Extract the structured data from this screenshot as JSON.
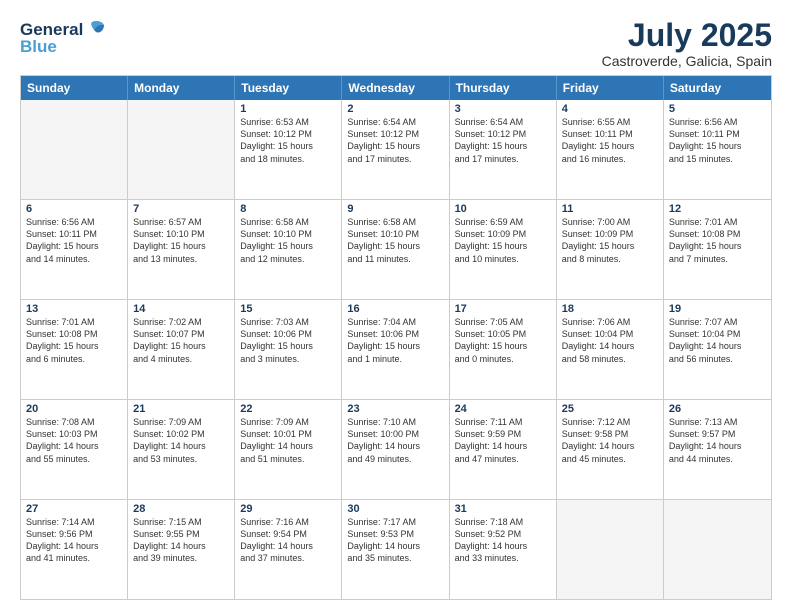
{
  "header": {
    "logo_line1": "General",
    "logo_line2": "Blue",
    "month": "July 2025",
    "location": "Castroverde, Galicia, Spain"
  },
  "weekdays": [
    "Sunday",
    "Monday",
    "Tuesday",
    "Wednesday",
    "Thursday",
    "Friday",
    "Saturday"
  ],
  "rows": [
    [
      {
        "day": "",
        "info": ""
      },
      {
        "day": "",
        "info": ""
      },
      {
        "day": "1",
        "info": "Sunrise: 6:53 AM\nSunset: 10:12 PM\nDaylight: 15 hours\nand 18 minutes."
      },
      {
        "day": "2",
        "info": "Sunrise: 6:54 AM\nSunset: 10:12 PM\nDaylight: 15 hours\nand 17 minutes."
      },
      {
        "day": "3",
        "info": "Sunrise: 6:54 AM\nSunset: 10:12 PM\nDaylight: 15 hours\nand 17 minutes."
      },
      {
        "day": "4",
        "info": "Sunrise: 6:55 AM\nSunset: 10:11 PM\nDaylight: 15 hours\nand 16 minutes."
      },
      {
        "day": "5",
        "info": "Sunrise: 6:56 AM\nSunset: 10:11 PM\nDaylight: 15 hours\nand 15 minutes."
      }
    ],
    [
      {
        "day": "6",
        "info": "Sunrise: 6:56 AM\nSunset: 10:11 PM\nDaylight: 15 hours\nand 14 minutes."
      },
      {
        "day": "7",
        "info": "Sunrise: 6:57 AM\nSunset: 10:10 PM\nDaylight: 15 hours\nand 13 minutes."
      },
      {
        "day": "8",
        "info": "Sunrise: 6:58 AM\nSunset: 10:10 PM\nDaylight: 15 hours\nand 12 minutes."
      },
      {
        "day": "9",
        "info": "Sunrise: 6:58 AM\nSunset: 10:10 PM\nDaylight: 15 hours\nand 11 minutes."
      },
      {
        "day": "10",
        "info": "Sunrise: 6:59 AM\nSunset: 10:09 PM\nDaylight: 15 hours\nand 10 minutes."
      },
      {
        "day": "11",
        "info": "Sunrise: 7:00 AM\nSunset: 10:09 PM\nDaylight: 15 hours\nand 8 minutes."
      },
      {
        "day": "12",
        "info": "Sunrise: 7:01 AM\nSunset: 10:08 PM\nDaylight: 15 hours\nand 7 minutes."
      }
    ],
    [
      {
        "day": "13",
        "info": "Sunrise: 7:01 AM\nSunset: 10:08 PM\nDaylight: 15 hours\nand 6 minutes."
      },
      {
        "day": "14",
        "info": "Sunrise: 7:02 AM\nSunset: 10:07 PM\nDaylight: 15 hours\nand 4 minutes."
      },
      {
        "day": "15",
        "info": "Sunrise: 7:03 AM\nSunset: 10:06 PM\nDaylight: 15 hours\nand 3 minutes."
      },
      {
        "day": "16",
        "info": "Sunrise: 7:04 AM\nSunset: 10:06 PM\nDaylight: 15 hours\nand 1 minute."
      },
      {
        "day": "17",
        "info": "Sunrise: 7:05 AM\nSunset: 10:05 PM\nDaylight: 15 hours\nand 0 minutes."
      },
      {
        "day": "18",
        "info": "Sunrise: 7:06 AM\nSunset: 10:04 PM\nDaylight: 14 hours\nand 58 minutes."
      },
      {
        "day": "19",
        "info": "Sunrise: 7:07 AM\nSunset: 10:04 PM\nDaylight: 14 hours\nand 56 minutes."
      }
    ],
    [
      {
        "day": "20",
        "info": "Sunrise: 7:08 AM\nSunset: 10:03 PM\nDaylight: 14 hours\nand 55 minutes."
      },
      {
        "day": "21",
        "info": "Sunrise: 7:09 AM\nSunset: 10:02 PM\nDaylight: 14 hours\nand 53 minutes."
      },
      {
        "day": "22",
        "info": "Sunrise: 7:09 AM\nSunset: 10:01 PM\nDaylight: 14 hours\nand 51 minutes."
      },
      {
        "day": "23",
        "info": "Sunrise: 7:10 AM\nSunset: 10:00 PM\nDaylight: 14 hours\nand 49 minutes."
      },
      {
        "day": "24",
        "info": "Sunrise: 7:11 AM\nSunset: 9:59 PM\nDaylight: 14 hours\nand 47 minutes."
      },
      {
        "day": "25",
        "info": "Sunrise: 7:12 AM\nSunset: 9:58 PM\nDaylight: 14 hours\nand 45 minutes."
      },
      {
        "day": "26",
        "info": "Sunrise: 7:13 AM\nSunset: 9:57 PM\nDaylight: 14 hours\nand 44 minutes."
      }
    ],
    [
      {
        "day": "27",
        "info": "Sunrise: 7:14 AM\nSunset: 9:56 PM\nDaylight: 14 hours\nand 41 minutes."
      },
      {
        "day": "28",
        "info": "Sunrise: 7:15 AM\nSunset: 9:55 PM\nDaylight: 14 hours\nand 39 minutes."
      },
      {
        "day": "29",
        "info": "Sunrise: 7:16 AM\nSunset: 9:54 PM\nDaylight: 14 hours\nand 37 minutes."
      },
      {
        "day": "30",
        "info": "Sunrise: 7:17 AM\nSunset: 9:53 PM\nDaylight: 14 hours\nand 35 minutes."
      },
      {
        "day": "31",
        "info": "Sunrise: 7:18 AM\nSunset: 9:52 PM\nDaylight: 14 hours\nand 33 minutes."
      },
      {
        "day": "",
        "info": ""
      },
      {
        "day": "",
        "info": ""
      }
    ]
  ]
}
